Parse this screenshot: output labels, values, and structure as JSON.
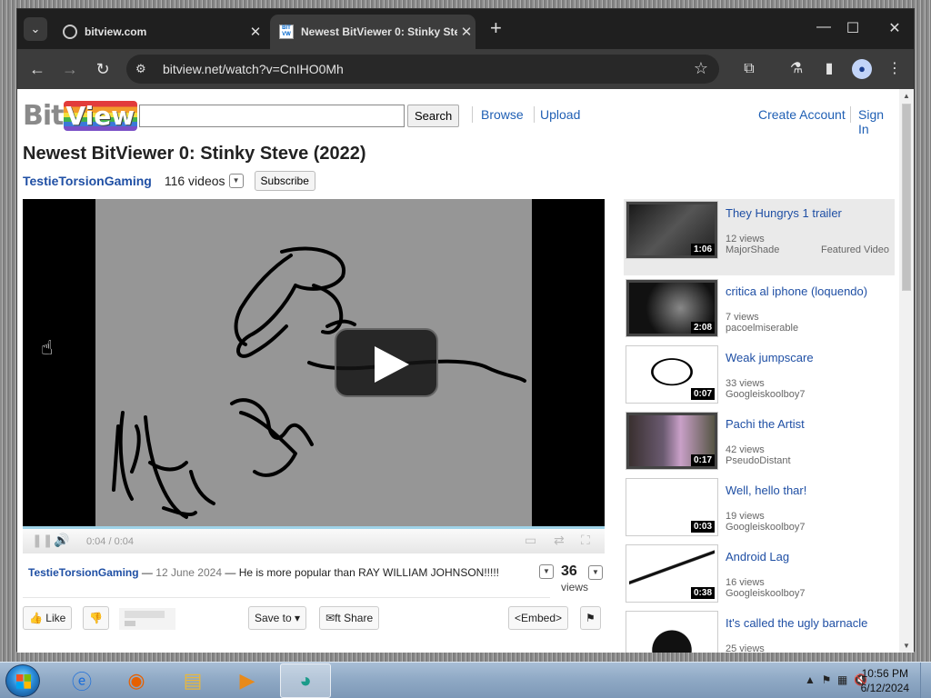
{
  "browser": {
    "tabs": [
      {
        "title": "bitview.com",
        "active": false
      },
      {
        "title": "Newest BitViewer 0: Stinky Ste",
        "active": true
      }
    ],
    "url": "bitview.net/watch?v=CnIHO0Mh",
    "icons": {
      "tab_search": "chevron-down-icon",
      "back": "back-arrow-icon",
      "forward": "forward-arrow-icon",
      "reload": "reload-icon",
      "bookmark": "star-icon",
      "extensions": "puzzle-icon",
      "labs": "flask-icon",
      "sidepanel": "side-panel-icon",
      "profile": "profile-icon",
      "menu": "kebab-menu-icon"
    }
  },
  "site": {
    "logo_bit": "Bit",
    "logo_view": "View",
    "search_value": "",
    "search_button": "Search",
    "nav": [
      "Browse",
      "Upload"
    ],
    "account": [
      "Create Account",
      "Sign In"
    ]
  },
  "video": {
    "title": "Newest BitViewer 0: Stinky Steve (2022)",
    "channel": "TestieTorsionGaming",
    "video_count": "116 videos",
    "subscribe": "Subscribe",
    "time": "0:04 / 0:04",
    "progress": 1.0,
    "uploader": "TestieTorsionGaming",
    "date": "12 June 2024",
    "description": "He is more popular than RAY WILLIAM JOHNSON!!!!!",
    "views_count": "36",
    "views_label": "views",
    "like": "Like",
    "save_to": "Save to",
    "share": "Share",
    "embed": "<Embed>"
  },
  "related": [
    {
      "title": "They Hungrys 1 trailer",
      "views": "12 views",
      "user": "MajorShade",
      "duration": "1:06",
      "featured": "Featured Video"
    },
    {
      "title": "critica al iphone (loquendo)",
      "views": "7 views",
      "user": "pacoelmiserable",
      "duration": "2:08"
    },
    {
      "title": "Weak jumpscare",
      "views": "33 views",
      "user": "Googleiskoolboy7",
      "duration": "0:07"
    },
    {
      "title": "Pachi the Artist",
      "views": "42 views",
      "user": "PseudoDistant",
      "duration": "0:17"
    },
    {
      "title": "Well, hello thar!",
      "views": "19 views",
      "user": "Googleiskoolboy7",
      "duration": "0:03"
    },
    {
      "title": "Android Lag",
      "views": "16 views",
      "user": "Googleiskoolboy7",
      "duration": "0:38"
    },
    {
      "title": "It's called the ugly barnacle",
      "views": "25 views",
      "user": "",
      "duration": ""
    }
  ],
  "taskbar": {
    "clock_time": "10:56 PM",
    "clock_date": "6/12/2024",
    "apps": [
      "internet-explorer-icon",
      "firefox-icon",
      "file-explorer-icon",
      "media-player-icon",
      "active-app-icon"
    ]
  }
}
